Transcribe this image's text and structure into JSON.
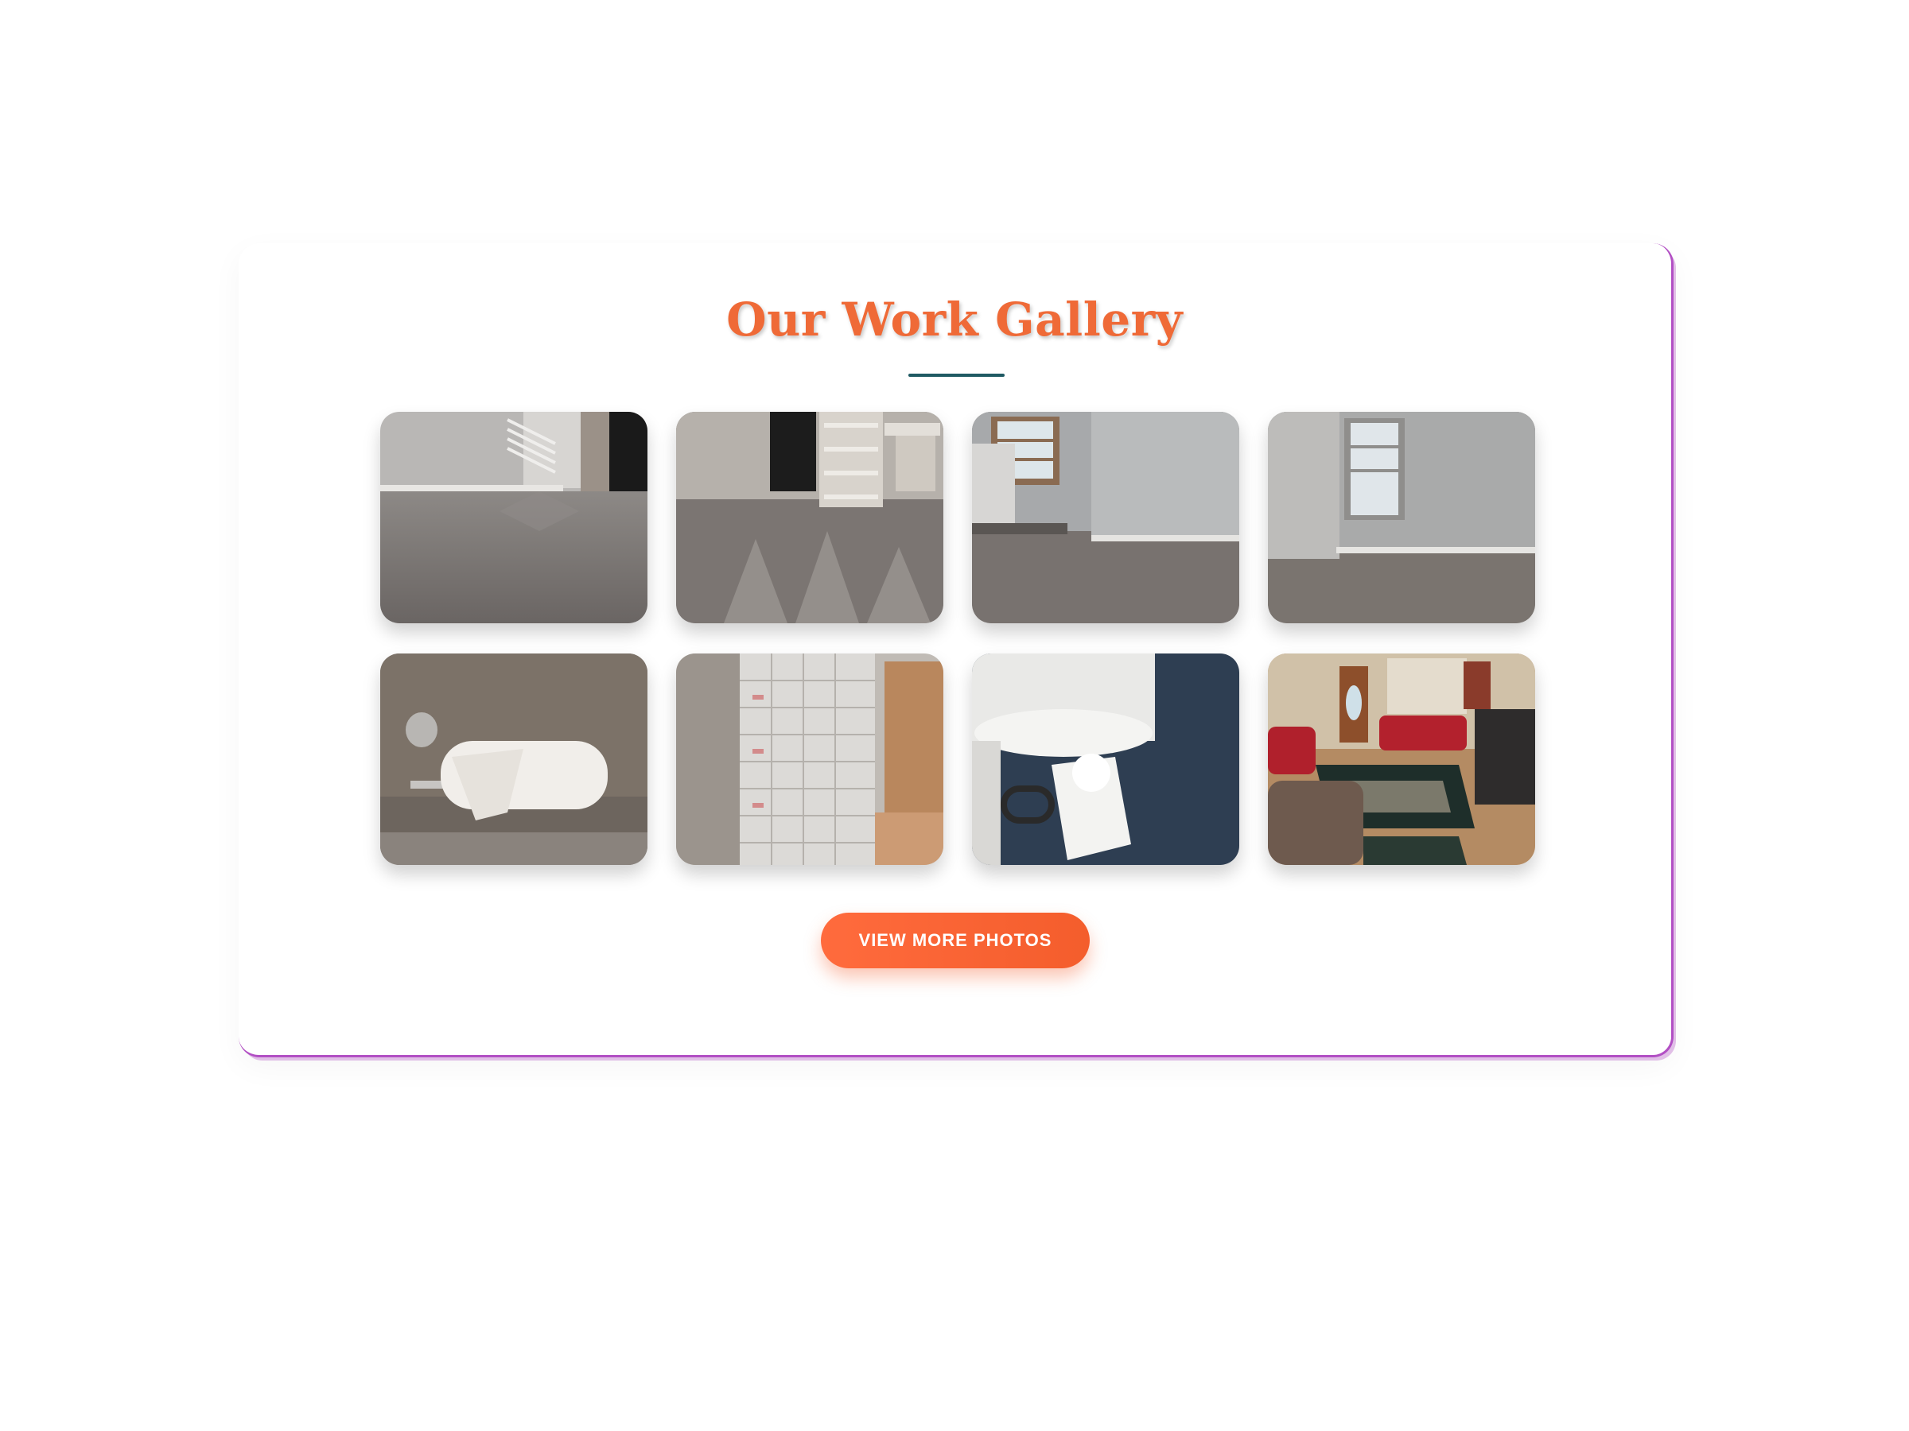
{
  "gallery": {
    "title": "Our Work Gallery",
    "button_label": "VIEW MORE PHOTOS",
    "accent_color": "#ef6a37",
    "underline_color": "#1f5a63",
    "frame_accent_color": "#b24fc4",
    "photos": [
      {
        "subject": "carpeted room with window blinds shadow"
      },
      {
        "subject": "carpeted room with white closet shelving"
      },
      {
        "subject": "empty room with window and carpet"
      },
      {
        "subject": "empty room with window and carpet"
      },
      {
        "subject": "toilet paper holder with folded tissue"
      },
      {
        "subject": "shoe storage boxes in closet"
      },
      {
        "subject": "toilet with white bow decoration"
      },
      {
        "subject": "living room with red sofas and rugs"
      }
    ]
  }
}
